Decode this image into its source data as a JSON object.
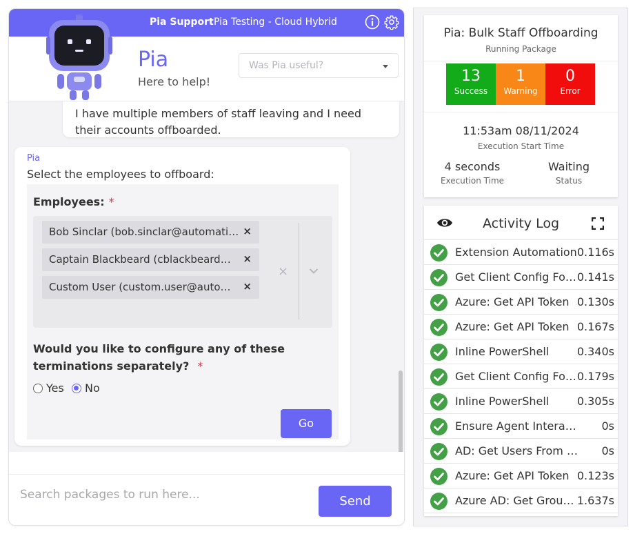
{
  "topbar": {
    "support_link": "Pia Support",
    "tenant": "Pia Testing - Cloud Hybrid",
    "info_icon": "info-circle-icon",
    "settings_icon": "gear-icon"
  },
  "header": {
    "brand": "Pia",
    "tagline": "Here to help!",
    "feedback_placeholder": "Was Pia useful?"
  },
  "conversation": {
    "user_message": "I have multiple members of staff leaving and I need their accounts offboarded.",
    "bot_name": "Pia",
    "bot_prompt": "Select the employees to offboard:",
    "form": {
      "employees_label": "Employees:",
      "required_mark": "*",
      "selected_employees": [
        "Bob Sinclar (bob.sinclar@automati…",
        "Captain Blackbeard (cblackbeard…",
        "Custom User (custom.user@auto…"
      ],
      "chip_remove": "×",
      "clear_all": "×",
      "question": "Would you like to configure any of these terminations separately?",
      "options": [
        "Yes",
        "No"
      ],
      "selected_option": "No",
      "submit_label": "Go"
    }
  },
  "composer": {
    "placeholder": "Search packages to run here...",
    "send_label": "Send"
  },
  "package": {
    "title": "Pia: Bulk Staff Offboarding",
    "subtitle": "Running Package",
    "counts": {
      "success": "13",
      "success_label": "Success",
      "warning": "1",
      "warning_label": "Warning",
      "error": "0",
      "error_label": "Error"
    },
    "colors": {
      "success": "#13ab1a",
      "warning": "#f98717",
      "error": "#f20d0d",
      "accent": "#6a66f5"
    },
    "start_time": "11:53am 08/11/2024",
    "start_time_label": "Execution Start Time",
    "exec_time": "4 seconds",
    "exec_time_label": "Execution Time",
    "status": "Waiting",
    "status_label": "Status"
  },
  "activity_log": {
    "title": "Activity Log",
    "view_icon": "eye-icon",
    "expand_icon": "fullscreen-icon",
    "entries": [
      {
        "name": "Extension Automation",
        "time": "0.116s"
      },
      {
        "name": "Get Client Config For…",
        "time": "0.141s"
      },
      {
        "name": "Azure: Get API Token",
        "time": "0.130s"
      },
      {
        "name": "Azure: Get API Token",
        "time": "0.167s"
      },
      {
        "name": "Inline PowerShell",
        "time": "0.340s"
      },
      {
        "name": "Get Client Config For…",
        "time": "0.179s"
      },
      {
        "name": "Inline PowerShell",
        "time": "0.305s"
      },
      {
        "name": "Ensure Agent Interac…",
        "time": "0s"
      },
      {
        "name": "AD: Get Users From …",
        "time": "0s"
      },
      {
        "name": "Azure: Get API Token",
        "time": "0.123s"
      },
      {
        "name": "Azure AD: Get Group…",
        "time": "1.637s"
      }
    ]
  }
}
